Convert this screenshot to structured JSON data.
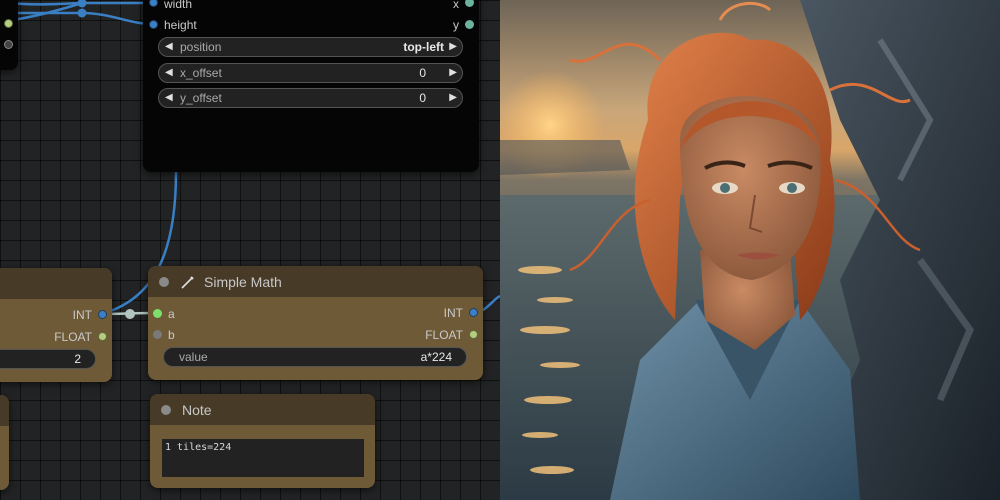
{
  "photo": {
    "description_icon": "portrait-photo"
  },
  "crop_node": {
    "outputs": [
      {
        "label": "width",
        "right_label": "x"
      },
      {
        "label": "height",
        "right_label": "y"
      }
    ],
    "widgets": [
      {
        "name": "position",
        "value": "top-left"
      },
      {
        "name": "x_offset",
        "value": "0"
      },
      {
        "name": "y_offset",
        "value": "0"
      }
    ]
  },
  "left_node": {
    "outputs": [
      {
        "label": "INT"
      },
      {
        "label": "FLOAT"
      }
    ],
    "widget_value": "2"
  },
  "math_node": {
    "title": "Simple Math",
    "inputs": [
      {
        "label": "a"
      },
      {
        "label": "b"
      }
    ],
    "outputs": [
      {
        "label": "INT"
      },
      {
        "label": "FLOAT"
      }
    ],
    "widget": {
      "name": "value",
      "value": "a*224"
    }
  },
  "note_node": {
    "title": "Note",
    "text": "1 tiles=224"
  },
  "colors": {
    "wire": "#3a7fc4",
    "int_port": "#3b7fc7",
    "float_port": "#b5cd7e",
    "node_header": "#473a27",
    "node_body": "#6e5a37"
  }
}
